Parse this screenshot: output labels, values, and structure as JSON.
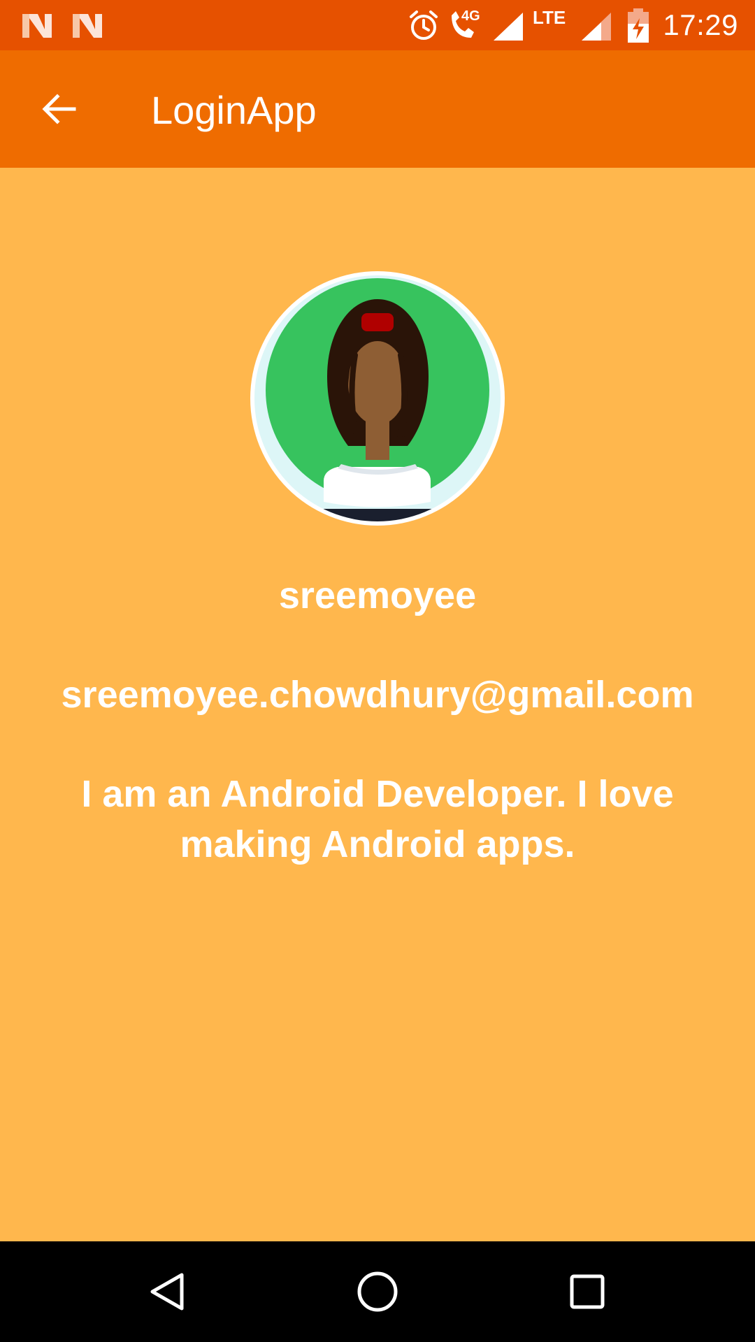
{
  "status_bar": {
    "time": "17:29",
    "network_label": "LTE",
    "call_label": "4G",
    "icons": [
      "notification-n-icon",
      "notification-n-icon",
      "alarm-icon",
      "wifi-call-icon",
      "signal-icon",
      "lte-signal-icon",
      "battery-charging-icon"
    ]
  },
  "app_bar": {
    "title": "LoginApp",
    "back_icon": "arrow-back-icon"
  },
  "profile": {
    "name": "sreemoyee",
    "email": "sreemoyee.chowdhury@gmail.com",
    "bio": "I am an Android Developer. I love making Android apps."
  },
  "nav_bar": {
    "buttons": [
      "back-triangle-icon",
      "home-circle-icon",
      "recents-square-icon"
    ]
  },
  "colors": {
    "status_bar": "#E65100",
    "app_bar": "#EF6C00",
    "background": "#FFB74D",
    "avatar_bg": "#37C35E"
  }
}
